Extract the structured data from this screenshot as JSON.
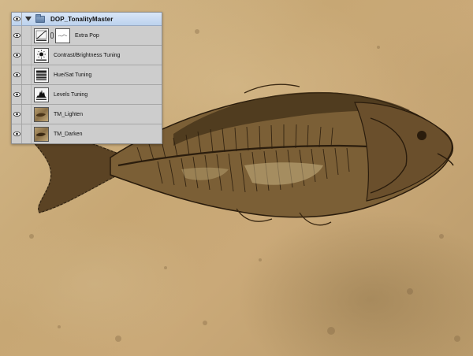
{
  "canvas": {
    "subject": "fish-fossil"
  },
  "layers_panel": {
    "group": {
      "name": "DOP_TonalityMaster",
      "expanded": true,
      "visible": true
    },
    "layers": [
      {
        "name": "Extra Pop",
        "type": "curves-adjustment",
        "icon": "curves-icon",
        "has_mask": true,
        "visible": true
      },
      {
        "name": "Contrast/Brightness Tuning",
        "type": "brightness-contrast-adjustment",
        "icon": "brightness-icon",
        "visible": true
      },
      {
        "name": "Hue/Sat Tuning",
        "type": "hue-saturation-adjustment",
        "icon": "hue-sat-icon",
        "visible": true
      },
      {
        "name": "Levels Tuning",
        "type": "levels-adjustment",
        "icon": "levels-icon",
        "visible": true
      },
      {
        "name": "TM_Lighten",
        "type": "pixel-layer",
        "icon": "image-thumbnail",
        "visible": true
      },
      {
        "name": "TM_Darken",
        "type": "pixel-layer",
        "icon": "image-thumbnail",
        "visible": true
      }
    ]
  },
  "colors": {
    "panel_bg": "#cdcdcd",
    "group_highlight": "#c8dbf3",
    "stone": "#c9ad7f"
  }
}
